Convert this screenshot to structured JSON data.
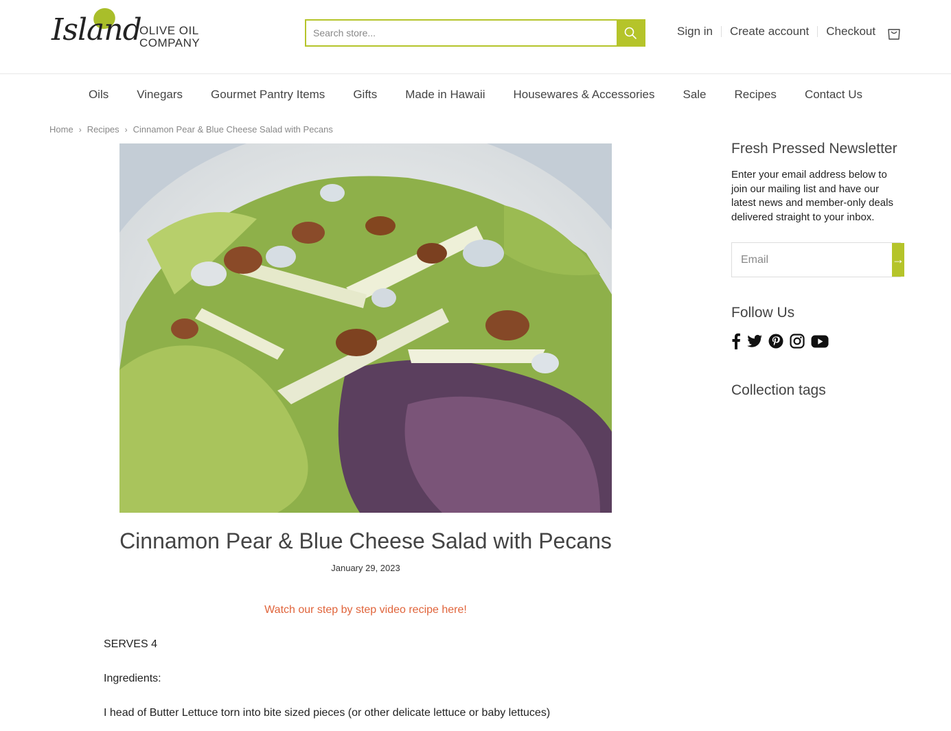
{
  "logo": {
    "script": "Island",
    "line1": "OLIVE OIL",
    "line2": "COMPANY"
  },
  "search": {
    "placeholder": "Search store..."
  },
  "account": {
    "sign_in": "Sign in",
    "create_account": "Create account",
    "checkout": "Checkout"
  },
  "nav": [
    "Oils",
    "Vinegars",
    "Gourmet Pantry Items",
    "Gifts",
    "Made in Hawaii",
    "Housewares & Accessories",
    "Sale",
    "Recipes",
    "Contact Us"
  ],
  "breadcrumb": {
    "home": "Home",
    "section": "Recipes",
    "current": "Cinnamon Pear & Blue Cheese Salad with Pecans"
  },
  "article": {
    "title": "Cinnamon Pear & Blue Cheese Salad with Pecans",
    "date": "January 29, 2023",
    "video_link": "Watch our step by step video recipe here!",
    "serves": "SERVES 4",
    "ingredients_label": "Ingredients:",
    "ingredient_1": "I head of Butter Lettuce torn into bite sized pieces (or other delicate lettuce or baby lettuces)"
  },
  "sidebar": {
    "newsletter_title": "Fresh Pressed Newsletter",
    "newsletter_text": "Enter your email address below to join our mailing list and have our latest news and member-only deals delivered straight to your inbox.",
    "email_placeholder": "Email",
    "submit_arrow": "→",
    "follow_title": "Follow Us",
    "tags_title": "Collection tags"
  },
  "colors": {
    "accent": "#b5c42a",
    "link": "#e0643b"
  },
  "icons": [
    "search-icon",
    "cart-icon",
    "facebook-icon",
    "twitter-icon",
    "pinterest-icon",
    "instagram-icon",
    "youtube-icon"
  ]
}
